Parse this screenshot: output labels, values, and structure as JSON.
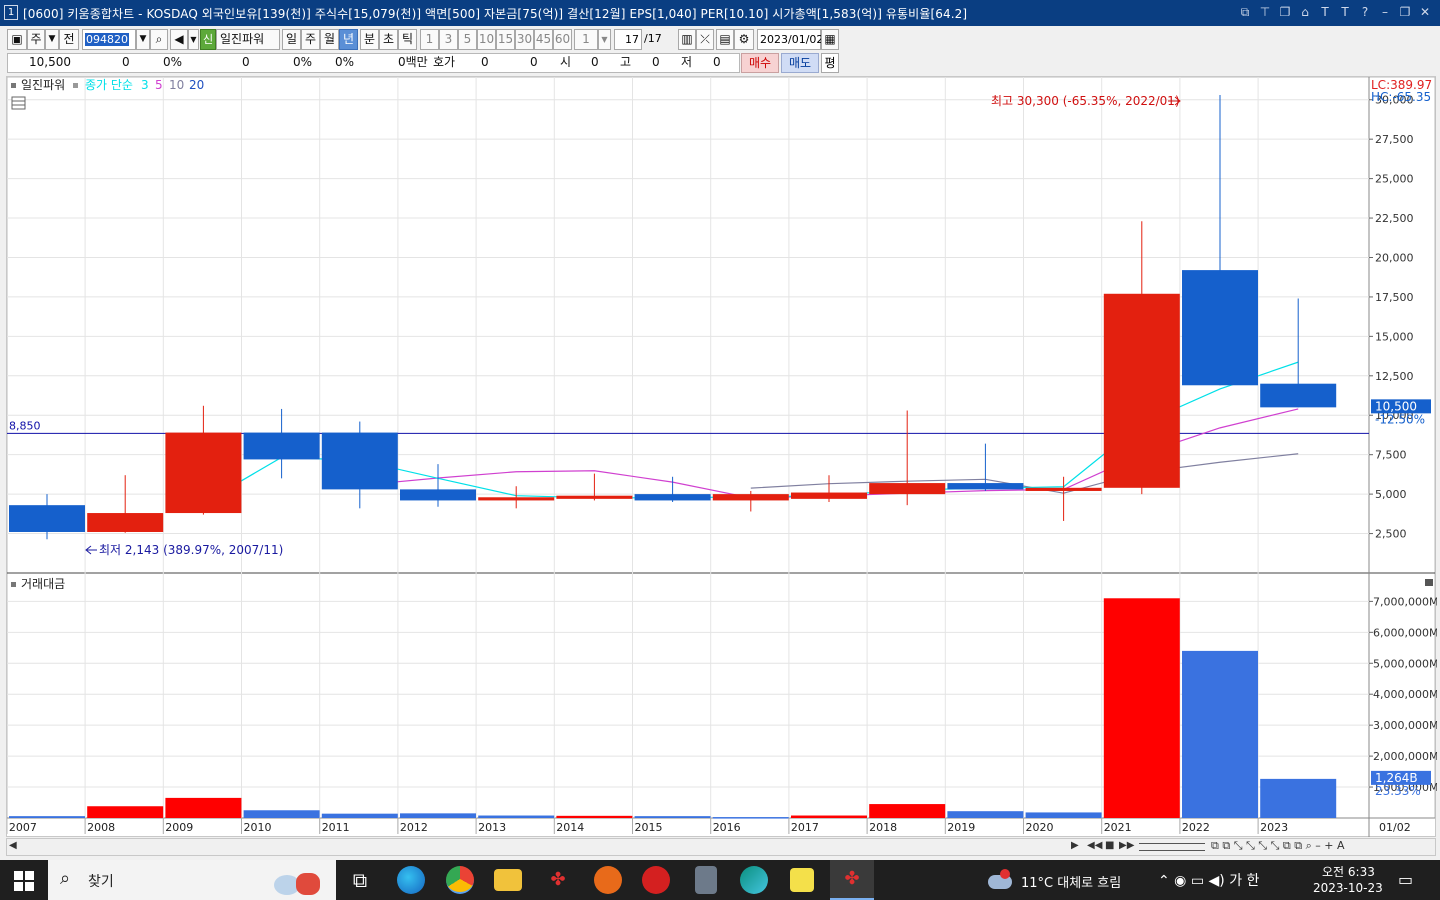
{
  "window": {
    "number": "1",
    "title": "[0600] 키움종합차트 - KOSDAQ 외국인보유[139(천)] 주식수[15,079(천)] 액면[500] 자본금[75(억)] 결산[12월] EPS[1,040] PER[10.10] 시가총액[1,583(억)] 유통비율[64.2]"
  },
  "toolbar": {
    "market_btn": "주",
    "prev_btn": "전",
    "stock_code": "094820",
    "stock_name": "일진파워",
    "badge": "신",
    "periods": [
      "일",
      "주",
      "월",
      "년",
      "분",
      "초",
      "틱"
    ],
    "selected_period": "년",
    "minute_intervals": [
      "1",
      "3",
      "5",
      "10",
      "15",
      "30",
      "45",
      "60"
    ],
    "interval_value": "1",
    "page_counter": "17",
    "page_total": "/17",
    "date": "2023/01/02"
  },
  "quote": {
    "price": "10,500",
    "change": "0",
    "rate": "0%",
    "volume": "0",
    "vol_rate": "0%",
    "vol_rate2": "0%",
    "amount": "0백만",
    "hoga_label": "호가",
    "hoga1": "0",
    "hoga2": "0",
    "open_label": "시",
    "open": "0",
    "high_label": "고",
    "high": "0",
    "low_label": "저",
    "low": "0",
    "buy_label": "매수",
    "sell_label": "매도",
    "eval_label": "평"
  },
  "colors": {
    "up": "#e3200f",
    "down": "#1560cc",
    "vol_up": "#ff0000",
    "vol_down": "#3a72e0",
    "ma3": "#00e0e8",
    "ma5": "#d040d0",
    "ma10": "#8080a0",
    "ma20": "#2050c0",
    "hline": "#1010a8"
  },
  "price_panel": {
    "legend_stock": "일진파워",
    "legend_label": "종가 단순",
    "ma_periods": [
      "3",
      "5",
      "10",
      "20"
    ],
    "lc": "LC:389.97",
    "hc": "HC:-65.35",
    "last_price": "10,500",
    "last_change": "-12.50%",
    "hline_label": "8,850",
    "max_note": "최고 30,300 (-65.35%, 2022/01)",
    "min_note": "최저 2,143 (389.97%, 2007/11)",
    "y_ticks": [
      "2,500",
      "5,000",
      "7,500",
      "10,000",
      "12,500",
      "15,000",
      "17,500",
      "20,000",
      "22,500",
      "25,000",
      "27,500",
      "30,000"
    ]
  },
  "volume_panel": {
    "title": "거래대금",
    "last_value": "1,264B",
    "last_change": "23.33%",
    "y_ticks": [
      "1,000,000M",
      "2,000,000M",
      "3,000,000M",
      "4,000,000M",
      "5,000,000M",
      "6,000,000M",
      "7,000,000M"
    ]
  },
  "x_axis": {
    "labels": [
      "2007",
      "2008",
      "2009",
      "2010",
      "2011",
      "2012",
      "2013",
      "2014",
      "2015",
      "2016",
      "2017",
      "2018",
      "2019",
      "2020",
      "2021",
      "2022",
      "2023"
    ],
    "right_label": "01/02"
  },
  "chart_data": {
    "type": "candlestick",
    "categories": [
      "2007",
      "2008",
      "2009",
      "2010",
      "2011",
      "2012",
      "2013",
      "2014",
      "2015",
      "2016",
      "2017",
      "2018",
      "2019",
      "2020",
      "2021",
      "2022",
      "2023"
    ],
    "ohlc": [
      {
        "open": 4300,
        "high": 5000,
        "low": 2143,
        "close": 2600
      },
      {
        "open": 2600,
        "high": 6200,
        "low": 2550,
        "close": 3800
      },
      {
        "open": 3800,
        "high": 10600,
        "low": 3700,
        "close": 8900
      },
      {
        "open": 8900,
        "high": 10400,
        "low": 6000,
        "close": 7200
      },
      {
        "open": 8900,
        "high": 9600,
        "low": 4100,
        "close": 5300
      },
      {
        "open": 5300,
        "high": 6900,
        "low": 4200,
        "close": 4600
      },
      {
        "open": 4600,
        "high": 5500,
        "low": 4100,
        "close": 4800
      },
      {
        "open": 4700,
        "high": 6300,
        "low": 4600,
        "close": 4900
      },
      {
        "open": 5000,
        "high": 6100,
        "low": 4500,
        "close": 4600
      },
      {
        "open": 4600,
        "high": 5200,
        "low": 3900,
        "close": 5000
      },
      {
        "open": 4700,
        "high": 6200,
        "low": 4500,
        "close": 5100
      },
      {
        "open": 5000,
        "high": 10300,
        "low": 4300,
        "close": 5700
      },
      {
        "open": 5700,
        "high": 8200,
        "low": 5200,
        "close": 5300
      },
      {
        "open": 5200,
        "high": 6100,
        "low": 3300,
        "close": 5400
      },
      {
        "open": 5400,
        "high": 22300,
        "low": 5000,
        "close": 17700
      },
      {
        "open": 19200,
        "high": 30300,
        "low": 11900,
        "close": 11900
      },
      {
        "open": 12000,
        "high": 17400,
        "low": 10500,
        "close": 10500
      }
    ],
    "volume_amount_M": [
      60000,
      380000,
      650000,
      250000,
      140000,
      150000,
      80000,
      70000,
      60000,
      30000,
      80000,
      450000,
      220000,
      180000,
      7100000,
      5400000,
      1264000
    ],
    "volume_is_up": [
      false,
      true,
      true,
      false,
      false,
      false,
      false,
      true,
      false,
      false,
      true,
      true,
      false,
      false,
      true,
      false,
      false
    ],
    "ma3": [
      null,
      null,
      4433,
      7333,
      7133,
      6000,
      4900,
      4767,
      4767,
      4833,
      4900,
      5267,
      5367,
      5467,
      9467,
      11667,
      13367
    ],
    "ma5": [
      null,
      null,
      null,
      null,
      5560,
      6020,
      6420,
      6480,
      5760,
      4760,
      4880,
      5060,
      5220,
      5300,
      7540,
      9200,
      10400
    ],
    "ma10": [
      null,
      null,
      null,
      null,
      null,
      null,
      null,
      null,
      null,
      5380,
      5660,
      5820,
      5940,
      5060,
      6380,
      7020,
      7560
    ],
    "ylim_price": [
      0,
      30300
    ],
    "ylim_volume": [
      0,
      7400000
    ],
    "hline": 8850
  }
}
